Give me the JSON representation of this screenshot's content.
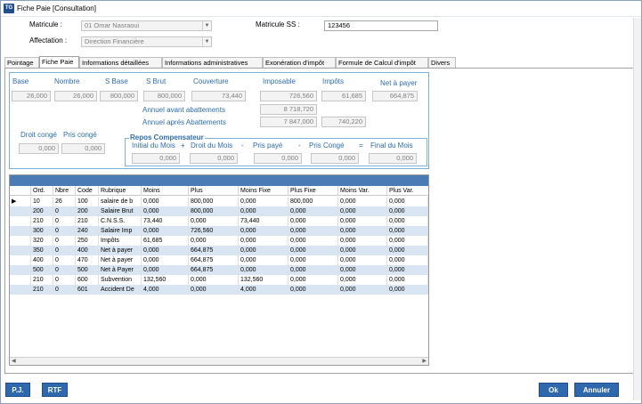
{
  "window": {
    "title": "Fiche Paie [Consultation]",
    "icon_text": "TG"
  },
  "header": {
    "matricule_label": "Matricule :",
    "matricule_value": "01 Omar Nasraoui",
    "affectation_label": "Affectation :",
    "affectation_value": "Direction Financière",
    "matricule_ss_label": "Matricule SS :",
    "matricule_ss_value": "123456"
  },
  "tabs": [
    "Pointage",
    "Fiche Paie",
    "Informations détaillées",
    "Informations administratives",
    "Exonération d'impôt",
    "Formule de Calcul d'impôt",
    "Divers"
  ],
  "summary": {
    "labels": {
      "base": "Base",
      "nombre": "Nombre",
      "sbase": "S Base",
      "sbrut": "S Brut",
      "couverture": "Couverture",
      "imposable": "Imposable",
      "impots": "Impôts",
      "net_a_payer": "Net à payer",
      "annuel_avant": "Annuel avant abattements",
      "annuel_apres": "Annuel aprés Abattements"
    },
    "values": {
      "base": "26,000",
      "nombre": "26,000",
      "sbase": "800,000",
      "sbrut": "800,000",
      "couverture": "73,440",
      "imposable": "726,560",
      "impots": "61,685",
      "net_a_payer": "664,875",
      "annuel_avant": "8 718,720",
      "annuel_apres": "7 847,000",
      "annuel_apres_impots": "740,220"
    }
  },
  "conge": {
    "droit_label": "Droit congé",
    "pris_label": "Pris congé",
    "droit_value": "0,000",
    "pris_value": "0,000"
  },
  "repos": {
    "title": "Repos Compensateur",
    "initial_label": "Initial du Mois",
    "plus": "+",
    "droit_label": "Droit du Mois",
    "minus1": "-",
    "pris_label": "Pris payé",
    "minus2": "-",
    "conge_label": "Pris Congé",
    "equals": "=",
    "final_label": "Final du Mois",
    "initial_value": "0,000",
    "droit_value": "0,000",
    "pris_value": "0,000",
    "conge_value": "0,000",
    "final_value": "0,000"
  },
  "grid": {
    "columns": [
      "Ord.",
      "Nbre",
      "Code",
      "Rubrique",
      "Moins",
      "Plus",
      "Moins Fixe",
      "Plus Fixe",
      "Moins Var.",
      "Plus Var."
    ],
    "rows": [
      [
        "10",
        "26",
        "100",
        "salaire de b",
        "0,000",
        "800,000",
        "0,000",
        "800,000",
        "0,000",
        "0,000"
      ],
      [
        "200",
        "0",
        "200",
        "Salaire Brut",
        "0,000",
        "800,000",
        "0,000",
        "0,000",
        "0,000",
        "0,000"
      ],
      [
        "210",
        "0",
        "210",
        "C.N.S.S.",
        "73,440",
        "0,000",
        "73,440",
        "0,000",
        "0,000",
        "0,000"
      ],
      [
        "300",
        "0",
        "240",
        "Salaire Imp",
        "0,000",
        "726,560",
        "0,000",
        "0,000",
        "0,000",
        "0,000"
      ],
      [
        "320",
        "0",
        "250",
        "Impôts",
        "61,685",
        "0,000",
        "0,000",
        "0,000",
        "0,000",
        "0,000"
      ],
      [
        "350",
        "0",
        "400",
        "Net à payer",
        "0,000",
        "664,875",
        "0,000",
        "0,000",
        "0,000",
        "0,000"
      ],
      [
        "400",
        "0",
        "470",
        "Net à payer",
        "0,000",
        "664,875",
        "0,000",
        "0,000",
        "0,000",
        "0,000"
      ],
      [
        "500",
        "0",
        "500",
        "Net à Payer",
        "0,000",
        "664,875",
        "0,000",
        "0,000",
        "0,000",
        "0,000"
      ],
      [
        "210",
        "0",
        "600",
        "Subvention",
        "132,560",
        "0,000",
        "132,560",
        "0,000",
        "0,000",
        "0,000"
      ],
      [
        "210",
        "0",
        "601",
        "Accident De",
        "4,000",
        "0,000",
        "4,000",
        "0,000",
        "0,000",
        "0,000"
      ]
    ],
    "row_indicator": "▶"
  },
  "buttons": {
    "pj": "P.J.",
    "rtf": "RTF",
    "ok": "Ok",
    "annuler": "Annuler"
  },
  "colors": {
    "accent": "#2f68ad",
    "label_blue": "#2e6db4",
    "row_alt": "#d9e5f2"
  }
}
